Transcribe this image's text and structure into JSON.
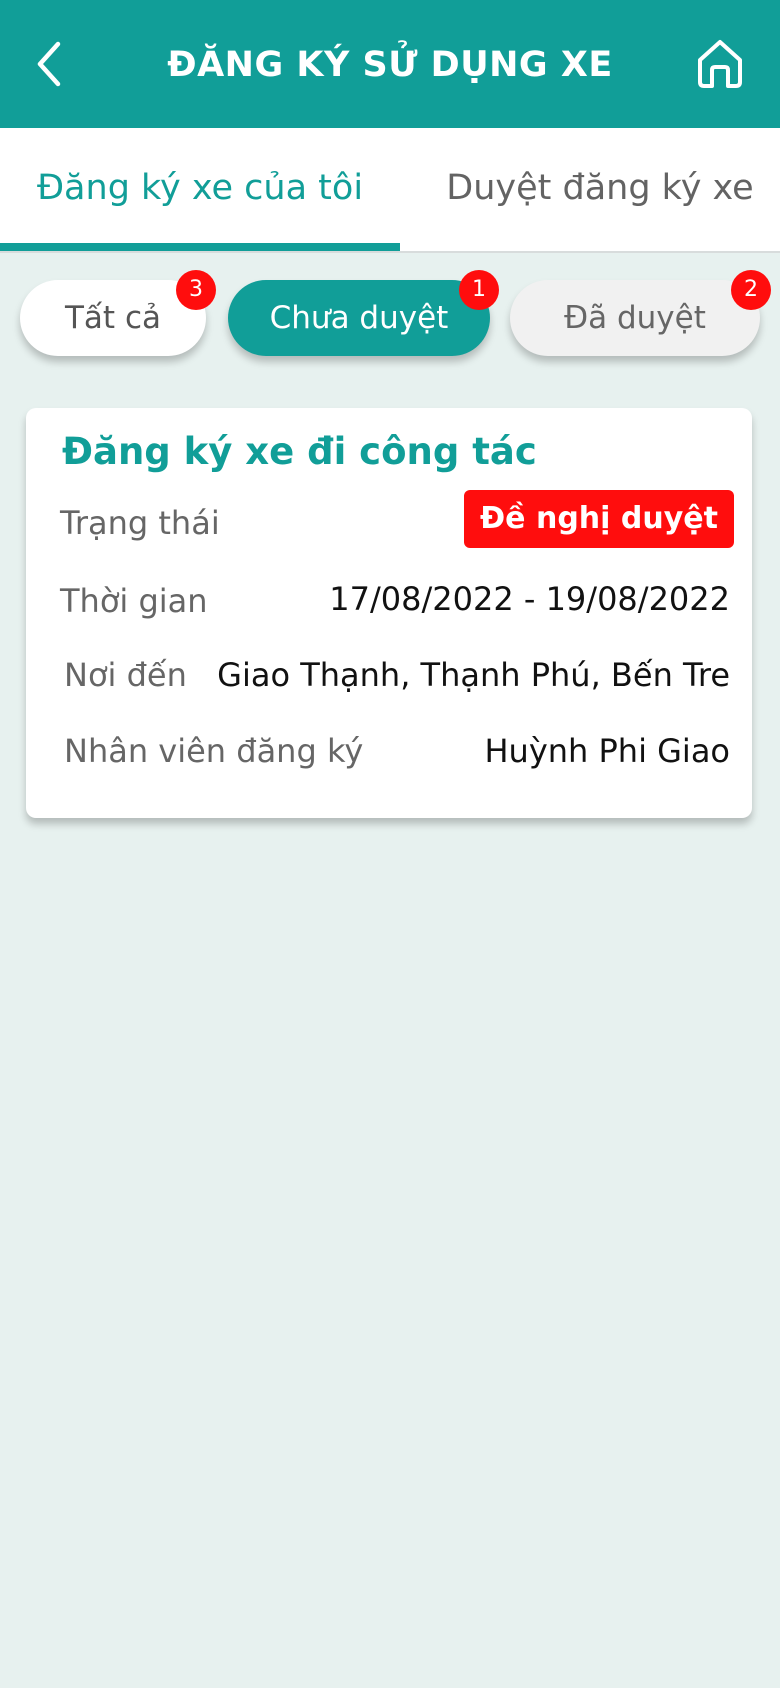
{
  "header": {
    "title": "ĐĂNG KÝ SỬ DỤNG XE",
    "back_icon": "chevron-left-icon",
    "home_icon": "home-icon"
  },
  "tabs": [
    {
      "label": "Đăng ký xe của tôi",
      "active": true
    },
    {
      "label": "Duyệt đăng ký xe",
      "active": false
    }
  ],
  "filters": [
    {
      "label": "Tất cả",
      "count": "3"
    },
    {
      "label": "Chưa duyệt",
      "count": "1",
      "selected": true
    },
    {
      "label": "Đã duyệt",
      "count": "2"
    }
  ],
  "card": {
    "title": "Đăng ký xe đi công tác",
    "status_label": "Trạng thái",
    "status_value": "Đề nghị duyệt",
    "time_label": "Thời gian",
    "time_value": "17/08/2022 - 19/08/2022",
    "destination_label": "Nơi đến",
    "destination_value": "Giao Thạnh, Thạnh Phú, Bến Tre",
    "employee_label": "Nhân viên đăng ký",
    "employee_value": "Huỳnh Phi Giao"
  },
  "colors": {
    "primary": "#119e98",
    "badge": "#ff0d0d",
    "background": "#e7f1ef"
  }
}
